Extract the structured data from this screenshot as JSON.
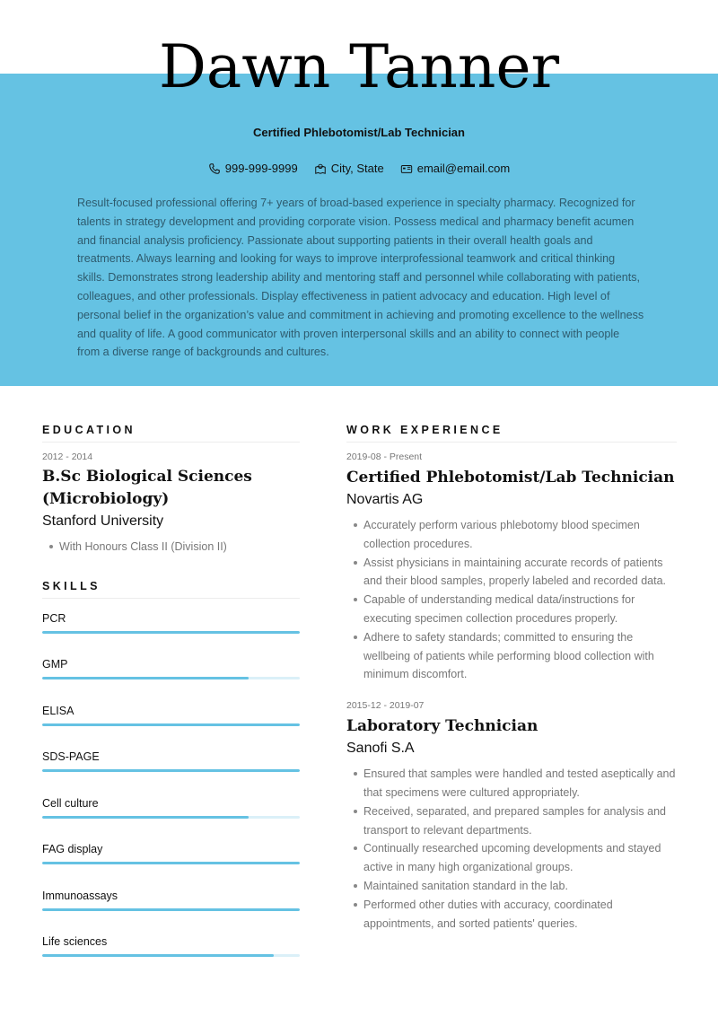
{
  "header": {
    "name": "Dawn Tanner",
    "headline": "Certified Phlebotomist/Lab Technician",
    "contacts": [
      {
        "icon": "phone-icon",
        "text": "999-999-9999"
      },
      {
        "icon": "location-icon",
        "text": "City, State"
      },
      {
        "icon": "mailbox-icon",
        "text": "email@email.com"
      }
    ],
    "summary": "Result-focused professional offering 7+ years of broad-based experience in specialty pharmacy. Recognized for talents in strategy development and providing corporate vision. Possess medical and pharmacy benefit acumen and financial analysis proficiency. Passionate about supporting patients in their overall health goals and treatments. Always learning and looking for ways to improve interprofessional teamwork and critical thinking skills. Demonstrates strong leadership ability and mentoring staff and personnel while collaborating with patients, colleagues, and other professionals. Display effectiveness in patient advocacy and education. High level of personal belief in the organization’s value and commitment in achieving and promoting excellence to the wellness and quality of life. A good communicator with proven interpersonal skills and an ability to connect with people from a diverse range of backgrounds and cultures."
  },
  "colors": {
    "accent": "#65c2e3",
    "accent_light": "#dbf0f8"
  },
  "education": {
    "title": "EDUCATION",
    "items": [
      {
        "date": "2012 - 2014",
        "degree": "B.Sc Biological Sciences (Microbiology)",
        "school": "Stanford University",
        "bullets": [
          "With Honours Class II (Division II)"
        ]
      }
    ]
  },
  "skills": {
    "title": "SKILLS",
    "items": [
      {
        "label": "PCR",
        "level": 1.0
      },
      {
        "label": "GMP",
        "level": 0.8
      },
      {
        "label": "ELISA",
        "level": 1.0
      },
      {
        "label": "SDS-PAGE",
        "level": 1.0
      },
      {
        "label": "Cell culture",
        "level": 0.8
      },
      {
        "label": "FAG display",
        "level": 1.0
      },
      {
        "label": "Immunoassays",
        "level": 1.0
      },
      {
        "label": "Life sciences",
        "level": 0.9
      }
    ]
  },
  "experience": {
    "title": "WORK EXPERIENCE",
    "jobs": [
      {
        "date": "2019-08 - Present",
        "title": "Certified Phlebotomist/Lab Technician",
        "company": "Novartis AG",
        "bullets": [
          "Accurately perform various phlebotomy blood specimen collection procedures.",
          "Assist physicians in maintaining accurate records of patients and their blood samples, properly labeled and recorded data.",
          "Capable of understanding medical data/instructions for executing specimen collection procedures properly.",
          "Adhere to safety standards; committed to ensuring the wellbeing of patients while performing blood collection with minimum discomfort."
        ]
      },
      {
        "date": "2015-12 - 2019-07",
        "title": "Laboratory Technician",
        "company": "Sanofi S.A",
        "bullets": [
          "Ensured that samples were handled and tested aseptically and that specimens were cultured appropriately.",
          "Received, separated, and prepared samples for analysis and transport to relevant departments.",
          "Continually researched upcoming developments and stayed active in many high organizational groups.",
          "Maintained sanitation standard in the lab.",
          "Performed other duties with accuracy, coordinated appointments, and sorted patients' queries."
        ]
      }
    ]
  }
}
